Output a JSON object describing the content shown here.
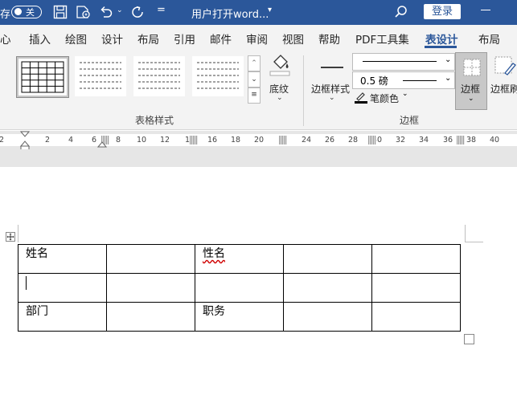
{
  "titlebar": {
    "autosave_label": "存",
    "autosave_state": "关",
    "doc_title": "用户打开word...",
    "login_label": "登录",
    "bg_color": "#2b579a"
  },
  "menu": {
    "items": [
      {
        "label": "心"
      },
      {
        "label": "插入"
      },
      {
        "label": "绘图"
      },
      {
        "label": "设计"
      },
      {
        "label": "布局"
      },
      {
        "label": "引用"
      },
      {
        "label": "邮件"
      },
      {
        "label": "审阅"
      },
      {
        "label": "视图"
      },
      {
        "label": "帮助"
      },
      {
        "label": "PDF工具集"
      },
      {
        "label": "表设计"
      },
      {
        "label": "布局"
      }
    ],
    "active_index": 11
  },
  "ribbon": {
    "table_styles_group": "表格样式",
    "shading_label": "底纹",
    "border_style_label": "边框样式",
    "line_weight": "0.5 磅",
    "pen_color_label": "笔颜色",
    "borders_label": "边框",
    "border_painter_label": "边框刷",
    "borders_group": "边框"
  },
  "ruler": {
    "numbers": [
      "2",
      "2",
      "4",
      "6",
      "8",
      "10",
      "12",
      "1",
      "16",
      "18",
      "20",
      "24",
      "26",
      "28",
      "30",
      "32",
      "34",
      "36",
      "38",
      "40"
    ]
  },
  "table": {
    "rows": [
      [
        "姓名",
        "",
        "性名",
        "",
        ""
      ],
      [
        "",
        "",
        "",
        "",
        ""
      ],
      [
        "部门",
        "",
        "职务",
        "",
        ""
      ]
    ]
  },
  "icons": {
    "save": "save-icon",
    "autosave_doc": "document-sync-icon",
    "undo": "undo-icon",
    "redo": "redo-icon",
    "customize": "customize-quick-access-icon",
    "search": "search-icon",
    "minimize": "minimize-icon",
    "move_handle": "table-move-handle-icon",
    "resize_handle": "table-resize-handle-icon"
  }
}
